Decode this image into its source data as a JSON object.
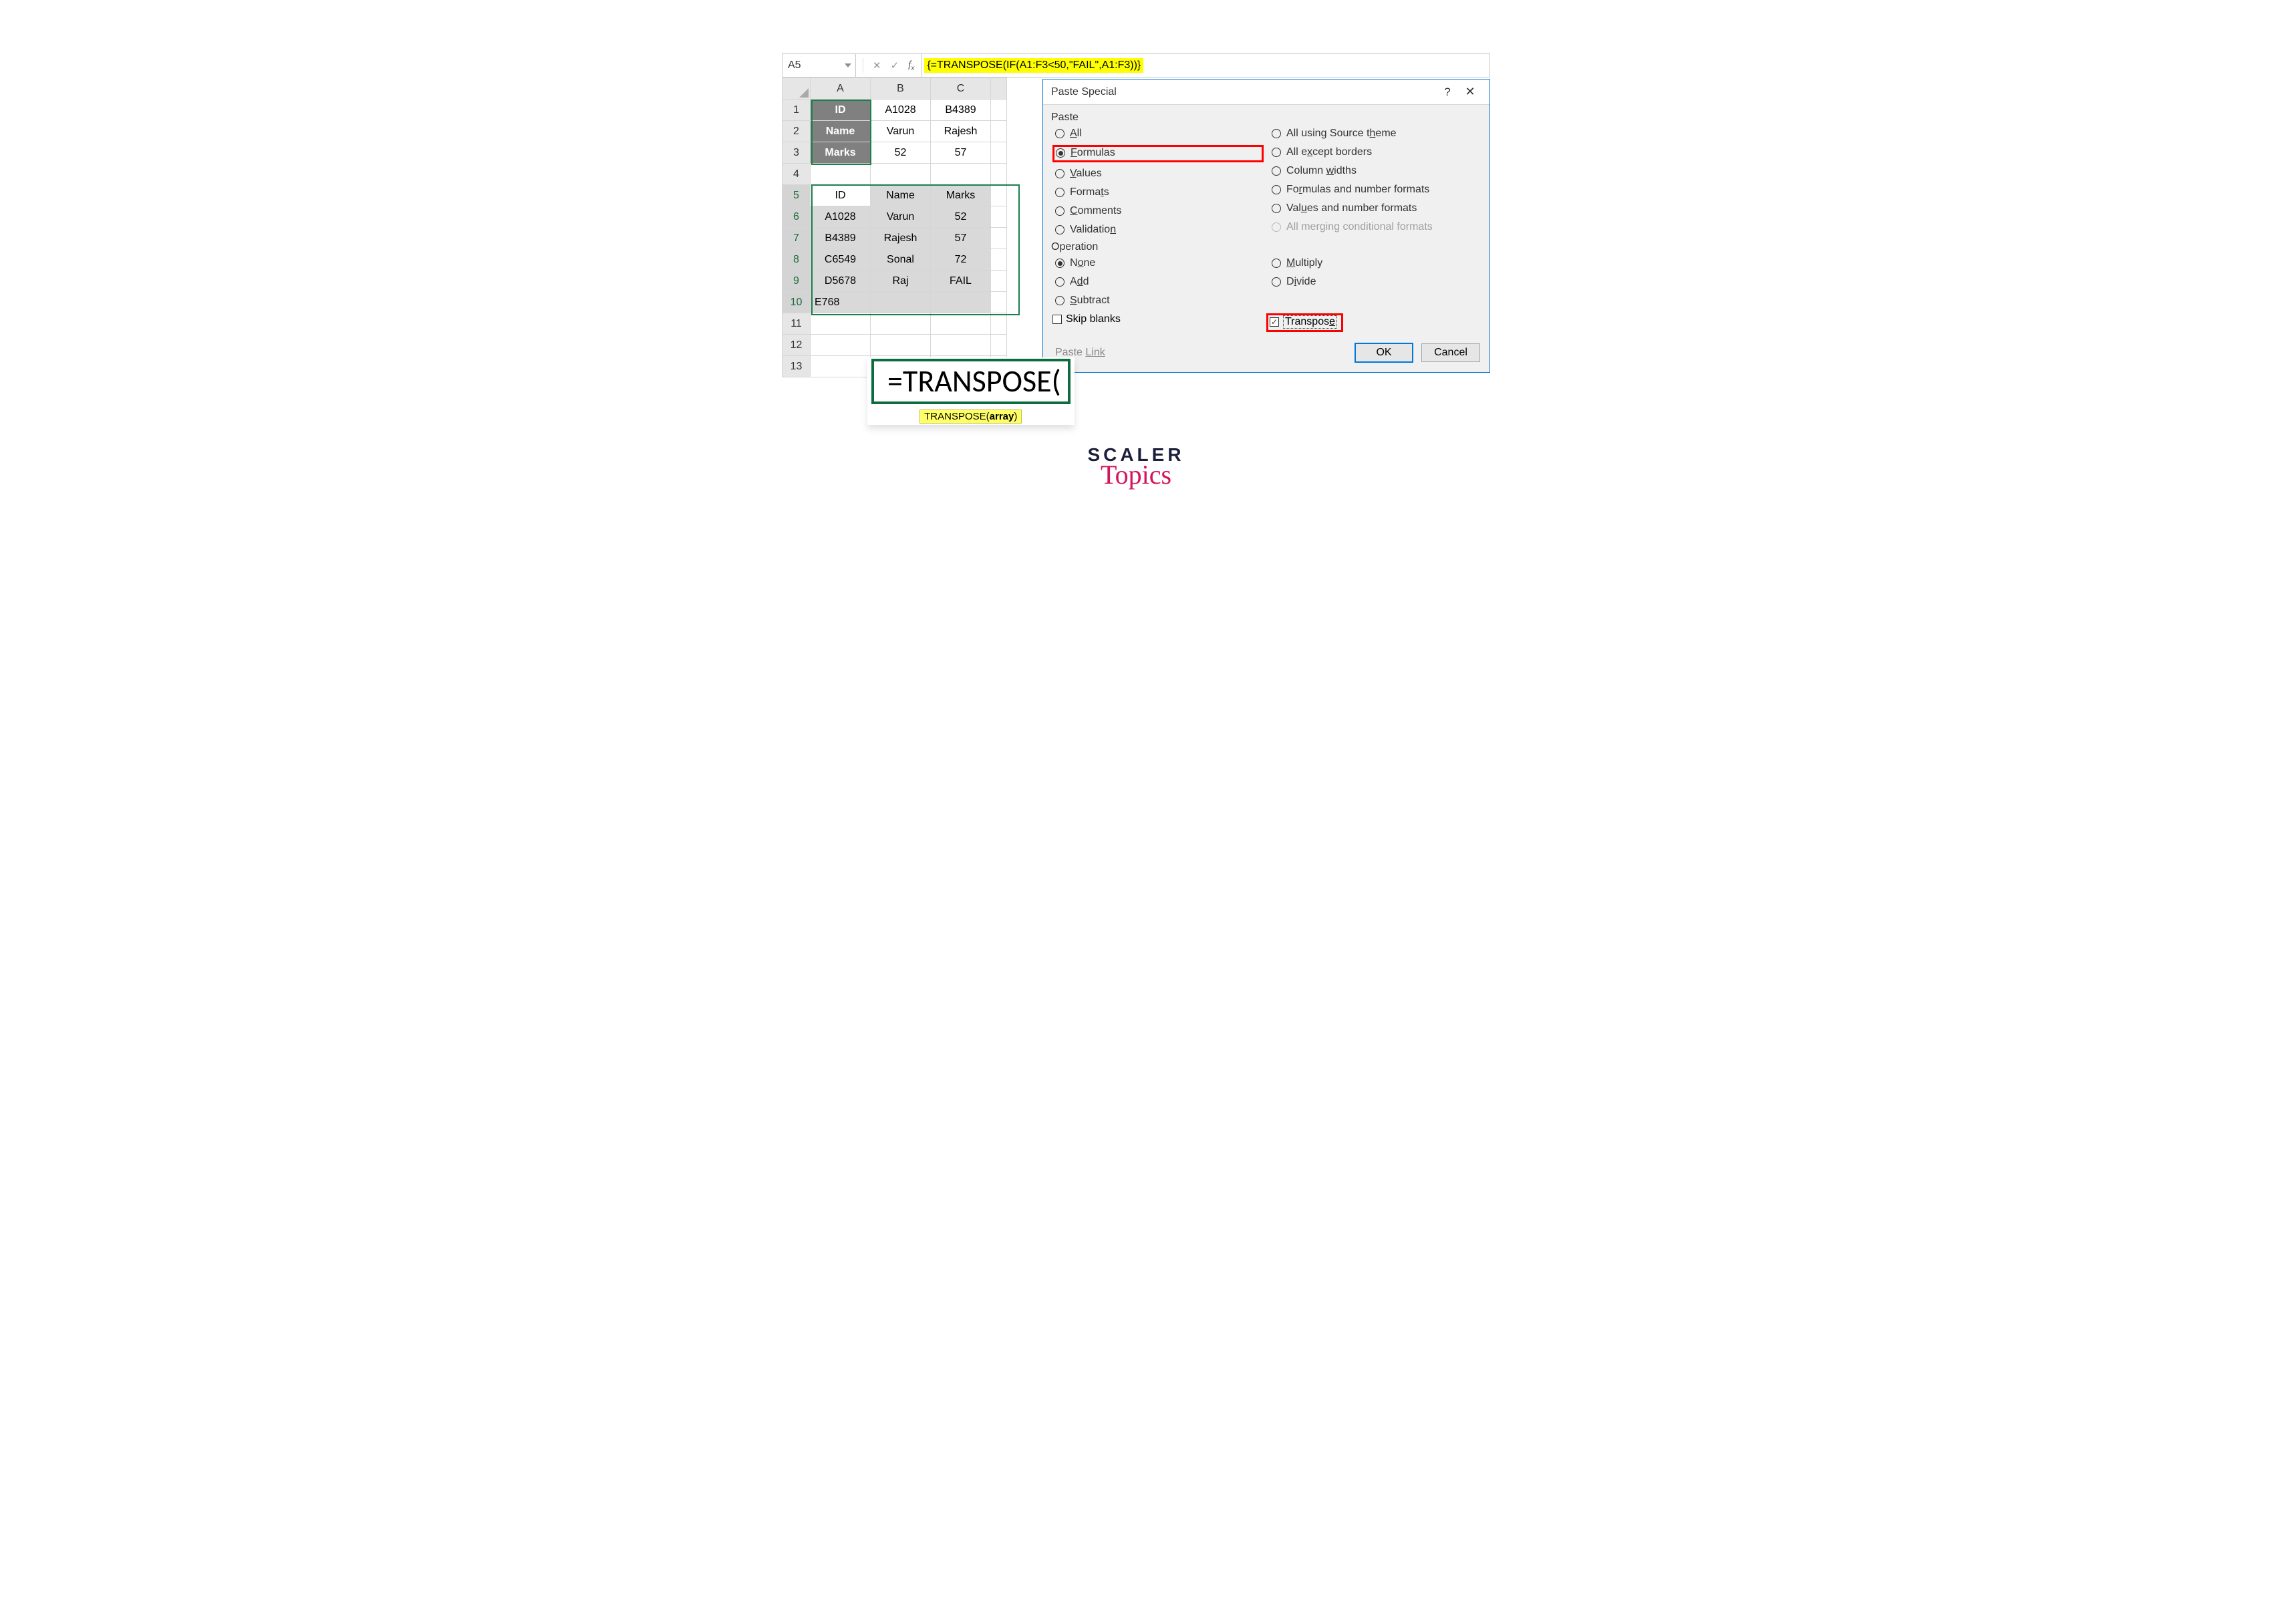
{
  "formula_bar": {
    "cell_ref": "A5",
    "formula": "{=TRANSPOSE(IF(A1:F3<50,\"FAIL\",A1:F3))}"
  },
  "columns": [
    "A",
    "B",
    "C"
  ],
  "rows": [
    "1",
    "2",
    "3",
    "4",
    "5",
    "6",
    "7",
    "8",
    "9",
    "10",
    "11",
    "12",
    "13"
  ],
  "top_table": {
    "r1": [
      "ID",
      "A1028",
      "B4389"
    ],
    "r2": [
      "Name",
      "Varun",
      "Rajesh"
    ],
    "r3": [
      "Marks",
      "52",
      "57"
    ]
  },
  "result_table": {
    "r5": [
      "ID",
      "Name",
      "Marks"
    ],
    "r6": [
      "A1028",
      "Varun",
      "52"
    ],
    "r7": [
      "B4389",
      "Rajesh",
      "57"
    ],
    "r8": [
      "C6549",
      "Sonal",
      "72"
    ],
    "r9": [
      "D5678",
      "Raj",
      "FAIL"
    ],
    "r10_a": "E768"
  },
  "dialog": {
    "title": "Paste Special",
    "section_paste": "Paste",
    "section_operation": "Operation",
    "paste_left": {
      "all": "All",
      "formulas": "Formulas",
      "values": "Values",
      "formats": "Formats",
      "comments": "Comments",
      "validation": "Validation"
    },
    "paste_right": {
      "all_theme": "All using Source theme",
      "except_borders": "All except borders",
      "col_widths": "Column widths",
      "form_num": "Formulas and number formats",
      "val_num": "Values and number formats",
      "merge_cond": "All merging conditional formats"
    },
    "op_left": {
      "none": "None",
      "add": "Add",
      "subtract": "Subtract"
    },
    "op_right": {
      "multiply": "Multiply",
      "divide": "Divide"
    },
    "skip_blanks": "Skip blanks",
    "skip_blanks_partial": "p blanks",
    "transpose": "Transpose",
    "paste_link": "Paste Link",
    "paste_link_partial": "Link",
    "ok": "OK",
    "cancel": "Cancel"
  },
  "overlay": {
    "text": "=TRANSPOSE(",
    "tooltip_prefix": "TRANSPOSE(",
    "tooltip_arg": "array",
    "tooltip_suffix": ")"
  },
  "logo": {
    "line1": "SCALER",
    "line2": "Topics"
  }
}
